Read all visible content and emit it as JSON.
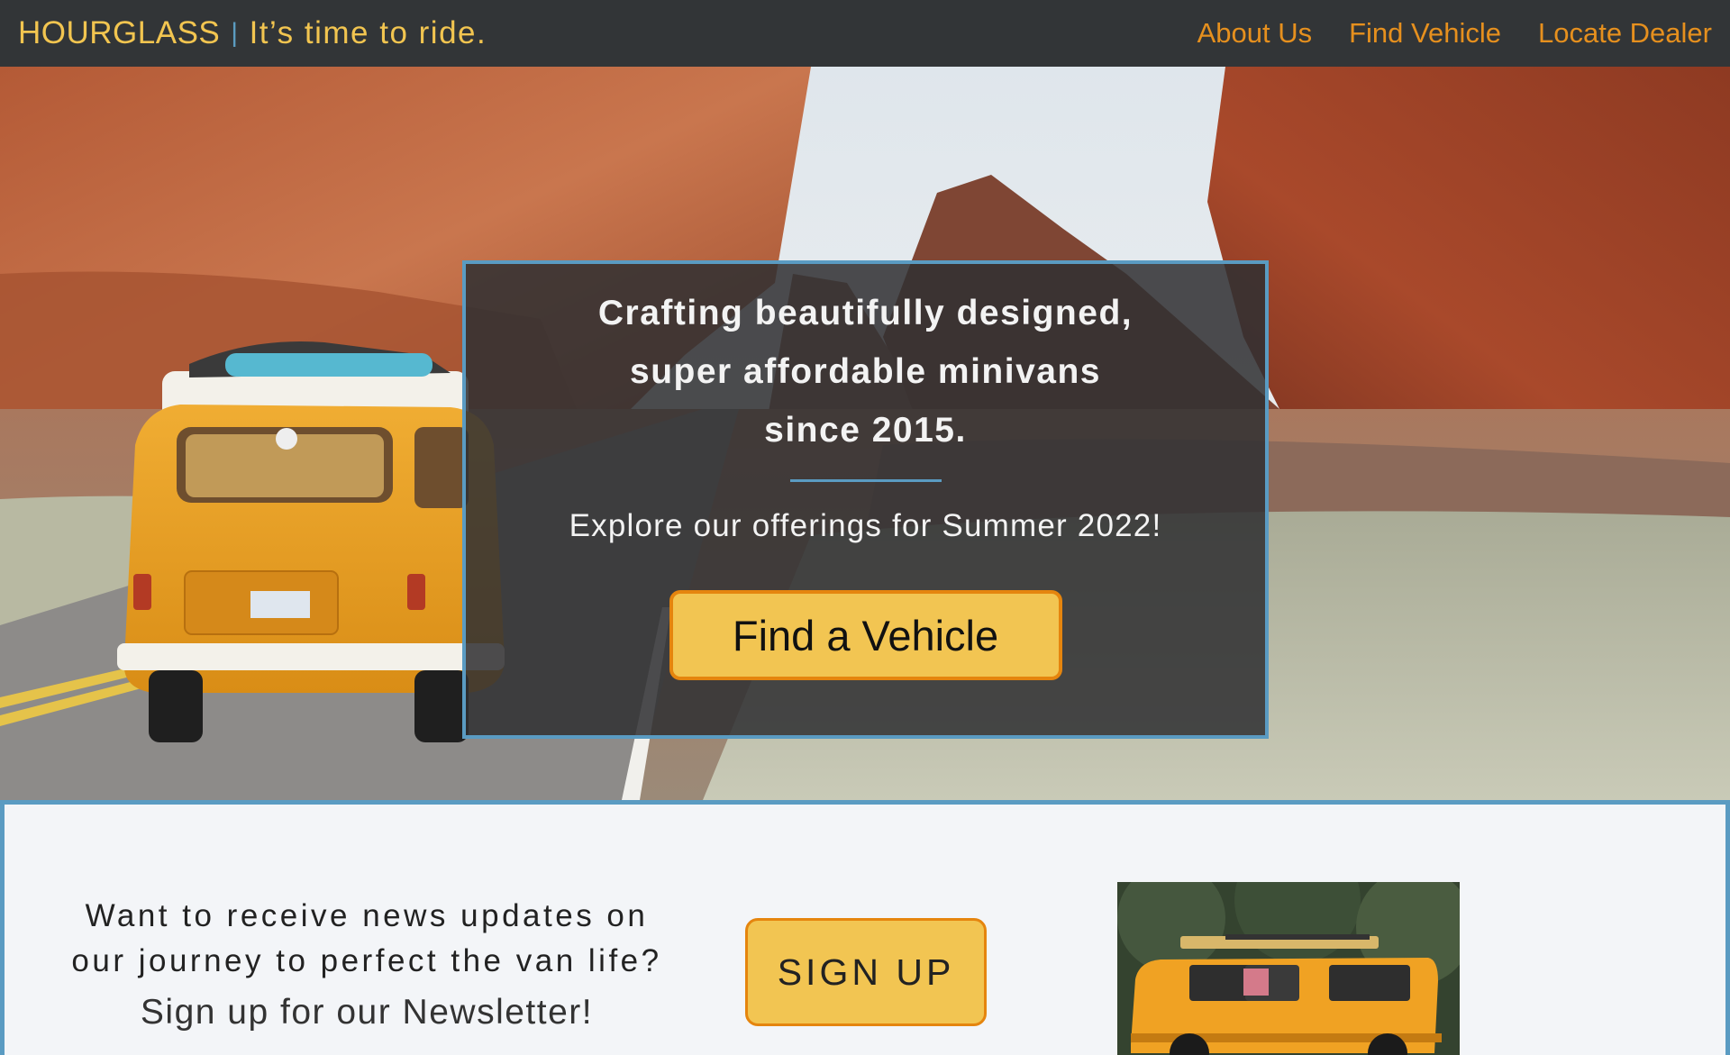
{
  "nav": {
    "brand_name": "HOURGLASS",
    "brand_separator": "|",
    "tagline": "It’s time to ride.",
    "links": [
      "About Us",
      "Find Vehicle",
      "Locate Dealer"
    ]
  },
  "hero": {
    "headline": "Crafting beautifully designed,\nsuper affordable minivans\nsince 2015.",
    "subtext": "Explore our offerings for Summer 2022!",
    "cta_label": "Find a Vehicle"
  },
  "newsletter": {
    "question": "Want to receive news updates on\nour journey to perfect the van life?",
    "cta_text": "Sign up for our Newsletter!",
    "button_label": "SIGN UP"
  },
  "colors": {
    "nav_bg": "#323537",
    "brand": "#f2c550",
    "link": "#e6901e",
    "accent_blue": "#5a9bc2",
    "button_fill": "#f2c552",
    "button_border": "#e5850e"
  }
}
